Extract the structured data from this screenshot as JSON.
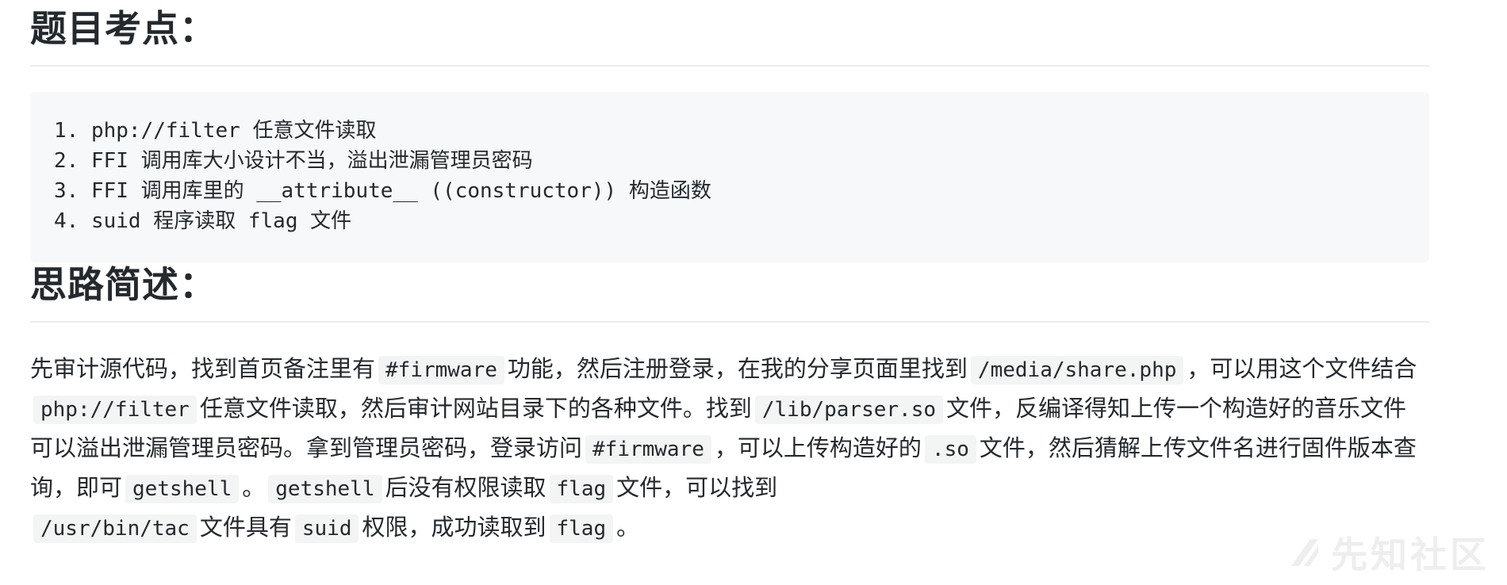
{
  "sections": {
    "exam_points_title": "题目考点：",
    "approach_title": "思路简述："
  },
  "code_block": {
    "lines": [
      "1. php://filter 任意文件读取",
      "2. FFI 调用库大小设计不当，溢出泄漏管理员密码",
      "3. FFI 调用库里的 __attribute__ ((constructor)) 构造函数",
      "4. suid 程序读取 flag 文件"
    ]
  },
  "paragraph": {
    "t1": "先审计源代码，找到首页备注里有",
    "c1": "#firmware",
    "t2": "功能，然后注册登录，在我的分享页面里找到",
    "c2": "/media/share.php",
    "t3": "，可以用这个文件结合",
    "c3": "php://filter",
    "t4": "任意文件读取，然后审计网站目录下的各种文件。找到",
    "c4": "/lib/parser.so",
    "t5": "文件，反编译得知上传一个构造好的音乐文件可以溢出泄漏管理员密码。拿到管理员密码，登录访问",
    "c5": "#firmware",
    "t6": "，可以上传构造好的",
    "c6": ".so",
    "t7": "文件，然后猜解上传文件名进行固件版本查询，即可",
    "c7": "getshell",
    "t8": "。",
    "c8": "getshell",
    "t9": "后没有权限读取",
    "c9": "flag",
    "t10": "文件，可以找到",
    "c10": "/usr/bin/tac",
    "t11": "文件具有",
    "c11": "suid",
    "t12": "权限，成功读取到",
    "c12": "flag",
    "t13": "。"
  },
  "watermark": {
    "text": "先知社区",
    "logo_icon": "xianzhi-logo-icon"
  }
}
